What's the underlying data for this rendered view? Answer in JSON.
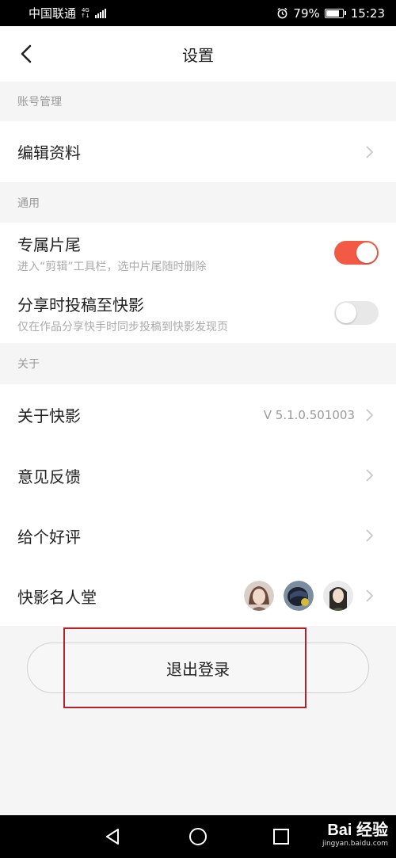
{
  "status_bar": {
    "carrier": "中国联通",
    "network": "4G",
    "network_sub": "↑↓",
    "battery_percent": "79%",
    "battery_level": 0.79,
    "time": "15:23"
  },
  "header": {
    "title": "设置"
  },
  "sections": {
    "account": {
      "title": "账号管理",
      "edit_profile": "编辑资料"
    },
    "general": {
      "title": "通用",
      "exclusive_ending": {
        "label": "专属片尾",
        "sub": "进入“剪辑”工具栏，选中片尾随时删除",
        "enabled": true
      },
      "share_submit": {
        "label": "分享时投稿至快影",
        "sub": "仅在作品分享快手时同步投稿到快影发现页",
        "enabled": false
      }
    },
    "about": {
      "title": "关于",
      "about_app": {
        "label": "关于快影",
        "version": "V 5.1.0.501003"
      },
      "feedback": "意见反馈",
      "rate": "给个好评",
      "hall_of_fame": "快影名人堂"
    }
  },
  "logout": "退出登录",
  "watermark": {
    "main": "Bai 经验",
    "sub": "jingyan.baidu.com"
  },
  "colors": {
    "accent": "#f25a45",
    "highlight": "#b3222a"
  },
  "icons": [
    "back-icon",
    "chevron-right-icon",
    "alarm-icon",
    "battery-icon",
    "signal-icon",
    "nav-back-icon",
    "nav-home-icon",
    "nav-recents-icon"
  ]
}
